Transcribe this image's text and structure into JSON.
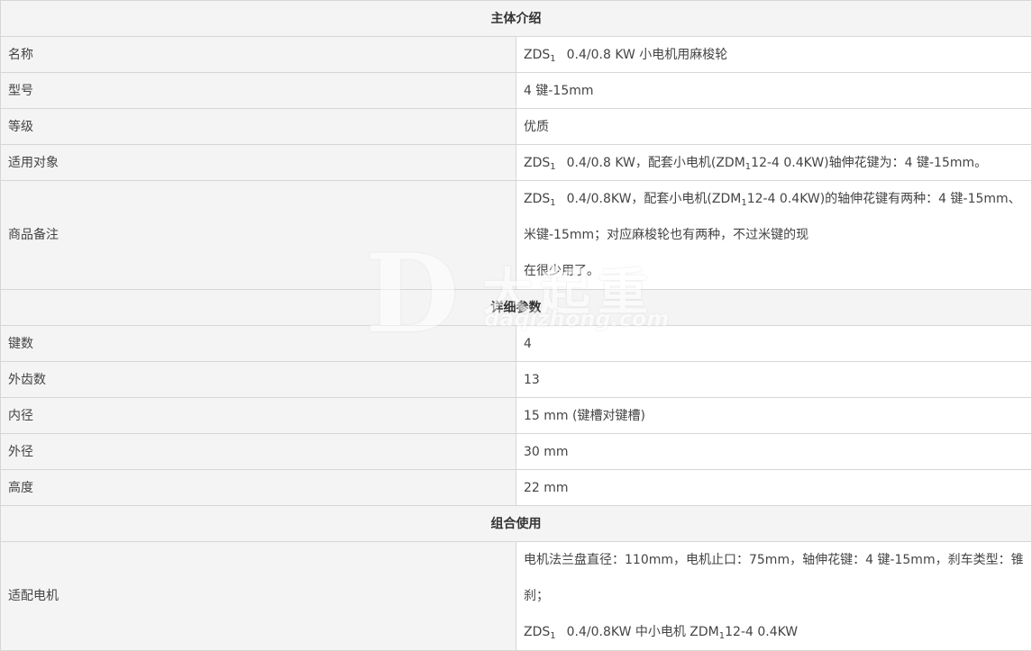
{
  "sections": {
    "intro": "主体介绍",
    "detail": "详细参数",
    "combo": "组合使用"
  },
  "intro_rows": {
    "name": {
      "label": "名称",
      "pre": "ZDS",
      "sub": "1",
      "post": "0.4/0.8 KW 小电机用麻梭轮"
    },
    "model": {
      "label": "型号",
      "value": "4 键-15mm"
    },
    "grade": {
      "label": "等级",
      "value": "优质"
    },
    "applicable": {
      "label": "适用对象",
      "pre": "ZDS",
      "sub": "1",
      "mid": "0.4/0.8 KW，配套小电机(ZDM",
      "sub2": "1",
      "post": "12-4   0.4KW)轴伸花键为：4 键-15mm。"
    },
    "remarks": {
      "label": "商品备注",
      "pre": "ZDS",
      "sub": "1",
      "mid": "0.4/0.8KW，配套小电机(ZDM",
      "sub2": "1",
      "post": "12-4   0.4KW)的轴伸花键有两种：4  键-15mm、米键-15mm；对应麻梭轮也有两种，不过米键的现",
      "line2": "在很少用了。"
    }
  },
  "detail_rows": [
    {
      "label": "键数",
      "value": "4"
    },
    {
      "label": "外齿数",
      "value": "13"
    },
    {
      "label": "内径",
      "value": "15 mm (键槽对键槽)"
    },
    {
      "label": "外径",
      "value": "30 mm"
    },
    {
      "label": "高度",
      "value": "22 mm"
    }
  ],
  "combo_rows": {
    "motor": {
      "label": "适配电机",
      "line1": "电机法兰盘直径：110mm，电机止口：75mm，轴伸花键：4 键-15mm，刹车类型：锥刹；",
      "pre": "ZDS",
      "sub": "1",
      "mid": "0.4/0.8KW  中小电机 ZDM",
      "sub2": "1",
      "post": "12-4   0.4KW"
    }
  },
  "watermark": {
    "letter": "D",
    "cn": "大起重",
    "en": "daqizhong.com"
  }
}
